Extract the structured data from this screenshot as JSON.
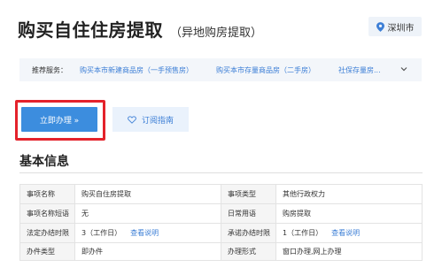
{
  "header": {
    "title": "购买自住住房提取",
    "subtitle": "（异地购房提取）",
    "location": "深圳市"
  },
  "recommend": {
    "label": "推荐服务：",
    "items": [
      "购买本市新建商品房（一手预售房）",
      "购买本市存量商品房（二手房）",
      "社保存量房..."
    ]
  },
  "actions": {
    "apply_label": "立即办理 »",
    "subscribe_label": "订阅指南"
  },
  "section": {
    "title": "基本信息"
  },
  "info_table": {
    "rows": [
      {
        "k1": "事项名称",
        "v1": "购买自住房提取",
        "k2": "事项类型",
        "v2": "其他行政权力"
      },
      {
        "k1": "事项名称短语",
        "v1": "无",
        "k2": "日常用语",
        "v2": "购房提取"
      },
      {
        "k1": "法定办结时限",
        "v1": "3（工作日）",
        "l1": "查看说明",
        "k2": "承诺办结时限",
        "v2": "1（工作日）",
        "l2": "查看说明"
      },
      {
        "k1": "办件类型",
        "v1": "即办件",
        "k2": "办理形式",
        "v2": "窗口办理,网上办理"
      }
    ]
  },
  "colors": {
    "primary": "#3c8dde",
    "link": "#3d7fd6",
    "highlight": "#e4222b"
  }
}
